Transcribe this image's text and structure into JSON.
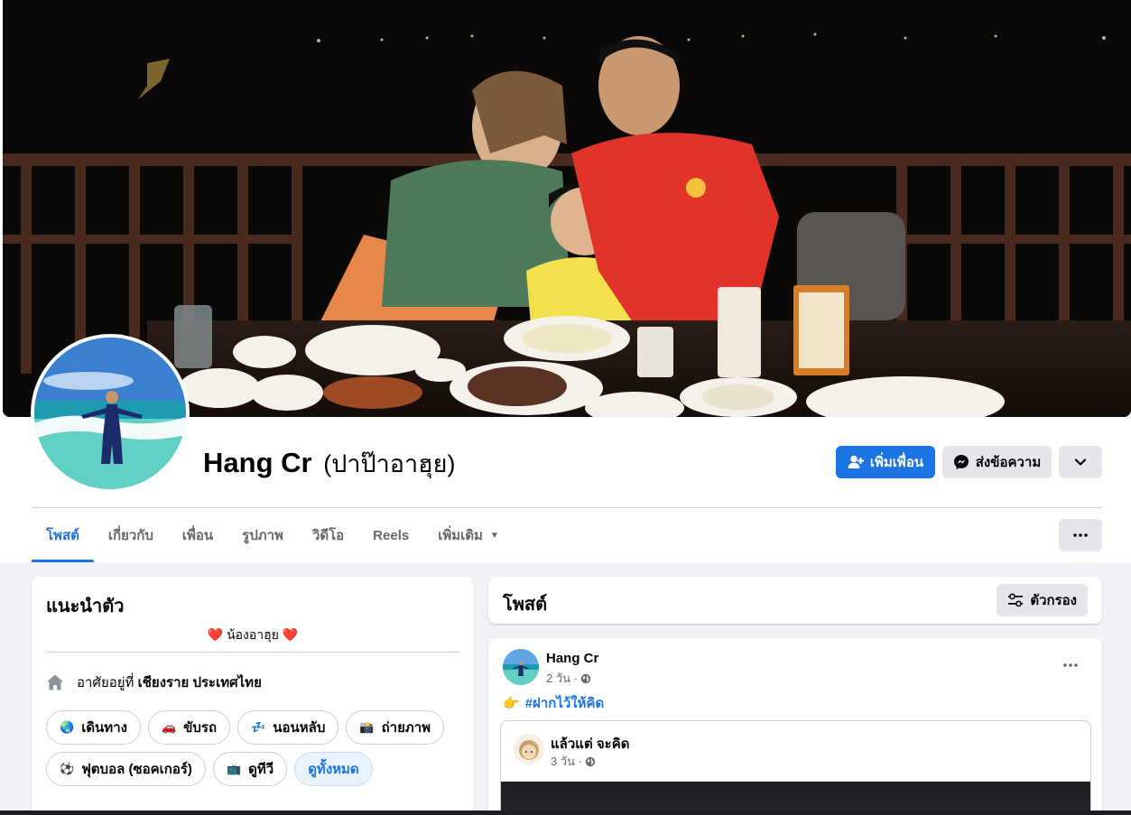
{
  "profile": {
    "name": "Hang Cr",
    "alt_name": "(ปาป๊าอาฮุย)",
    "add_friend_label": "เพิ่มเพื่อน",
    "message_label": "ส่งข้อความ"
  },
  "tabs": [
    {
      "label": "โพสต์"
    },
    {
      "label": "เกี่ยวกับ"
    },
    {
      "label": "เพื่อน"
    },
    {
      "label": "รูปภาพ"
    },
    {
      "label": "วิดีโอ"
    },
    {
      "label": "Reels"
    },
    {
      "label": "เพิ่มเติม"
    }
  ],
  "intro": {
    "title": "แนะนำตัว",
    "bio": "❤️ น้องอาฮุย ❤️",
    "lives_prefix": "อาศัยอยู่ที่",
    "lives_place": "เชียงราย ประเทศไทย",
    "hobbies": [
      {
        "icon": "🌏",
        "label": "เดินทาง"
      },
      {
        "icon": "🚗",
        "label": "ขับรถ"
      },
      {
        "icon": "💤",
        "label": "นอนหลับ"
      },
      {
        "icon": "📸",
        "label": "ถ่ายภาพ"
      },
      {
        "icon": "⚽",
        "label": "ฟุตบอล (ซอคเกอร์)"
      },
      {
        "icon": "📺",
        "label": "ดูทีวี"
      }
    ],
    "see_all_label": "ดูทั้งหมด"
  },
  "posts": {
    "title": "โพสต์",
    "filter_label": "ตัวกรอง",
    "post": {
      "author": "Hang Cr",
      "time": "2 วัน ·",
      "emoji": "👉",
      "text": "#ฝากไว้ให้คิด",
      "shared": {
        "author": "แล้วแต่ จะคิด",
        "time": "3 วัน ·"
      }
    }
  },
  "colors": {
    "accent": "#1b74e4",
    "background": "#f0f2f5",
    "button_gray": "#e4e6eb"
  }
}
